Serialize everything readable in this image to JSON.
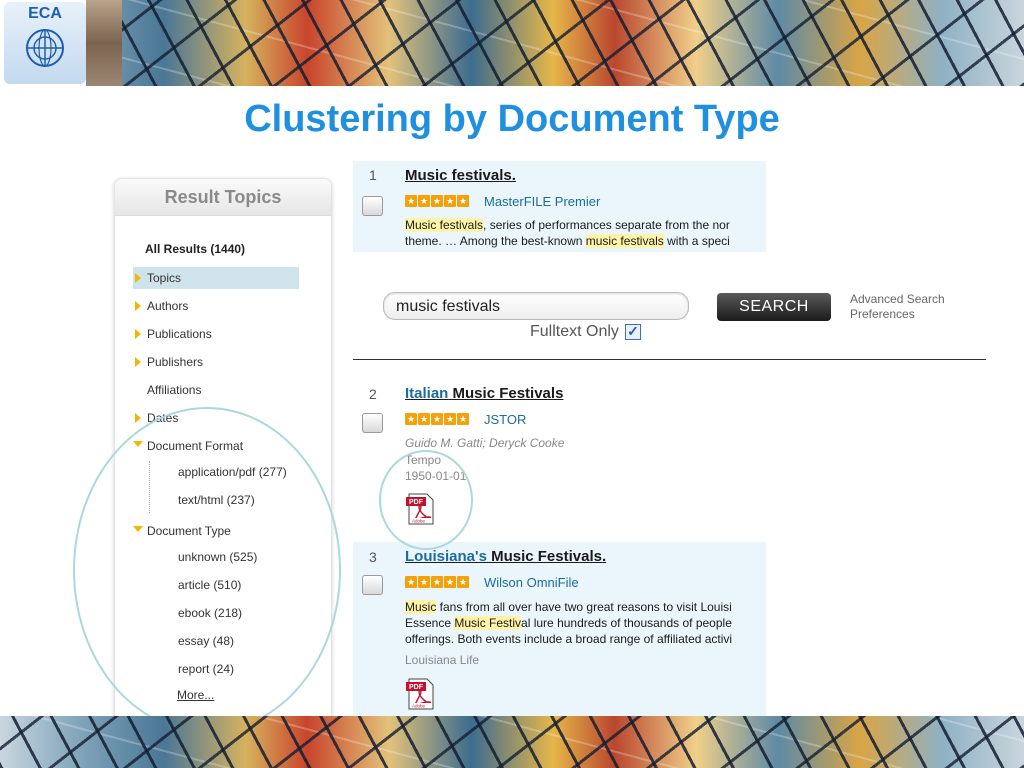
{
  "slide": {
    "title": "Clustering by Document Type",
    "logo_text": "ECA"
  },
  "sidebar": {
    "header": "Result Topics",
    "all_results": "All Results (1440)",
    "items": [
      {
        "label": "Topics",
        "expander": "collapsed",
        "highlighted": true
      },
      {
        "label": "Authors",
        "expander": "collapsed"
      },
      {
        "label": "Publications",
        "expander": "collapsed"
      },
      {
        "label": "Publishers",
        "expander": "collapsed"
      },
      {
        "label": "Affiliations",
        "expander": "none"
      },
      {
        "label": "Dates",
        "expander": "collapsed"
      },
      {
        "label": "Document Format",
        "expander": "expanded"
      },
      {
        "label": "Document Type",
        "expander": "expanded"
      }
    ],
    "document_format": [
      "application/pdf (277)",
      "text/html (237)"
    ],
    "document_type": [
      "unknown (525)",
      "article (510)",
      "ebook (218)",
      "essay (48)",
      "report (24)"
    ],
    "more": "More..."
  },
  "search": {
    "query": "music festivals",
    "button": "SEARCH",
    "fulltext_label": "Fulltext Only",
    "fulltext_checked": true,
    "advanced_search": "Advanced Search",
    "preferences": "Preferences"
  },
  "results": [
    {
      "number": "1",
      "title_plain": "Music festivals.",
      "source": "MasterFILE Premier",
      "stars": 5,
      "snippet": [
        [
          "Music festivals",
          ", series of performances separate from the nor"
        ],
        [
          "theme. … Among the best-known ",
          "music festivals",
          " with a speci"
        ]
      ]
    },
    {
      "number": "2",
      "title_link": "Italian",
      "title_rest": " Music Festivals",
      "source": "JSTOR",
      "stars": 5,
      "authors": "Guido M. Gatti; Deryck Cooke",
      "publication": "Tempo",
      "date": "1950-01-01"
    },
    {
      "number": "3",
      "title_link": "Louisiana's",
      "title_rest": " Music Festivals.",
      "source": "Wilson OmniFile",
      "stars": 5,
      "snippet": [
        [
          "Music",
          " fans from all over have two great reasons to visit Louisi"
        ],
        [
          "Essence ",
          "Music Festiv",
          "al lure hundreds of thousands of people"
        ],
        [
          "offerings. Both events include a broad range of affiliated activi"
        ]
      ],
      "publication": "Louisiana Life"
    }
  ],
  "icons": {
    "pdf": "pdf-file-icon",
    "star": "star-icon",
    "expand": "triangle-right-icon",
    "collapse": "triangle-down-icon"
  },
  "colors": {
    "title": "#1f8fe0",
    "accent_star": "#f4a20c",
    "result_bg": "#eaf6fb",
    "highlight": "#fff3a8",
    "circle": "#a9d8de"
  }
}
